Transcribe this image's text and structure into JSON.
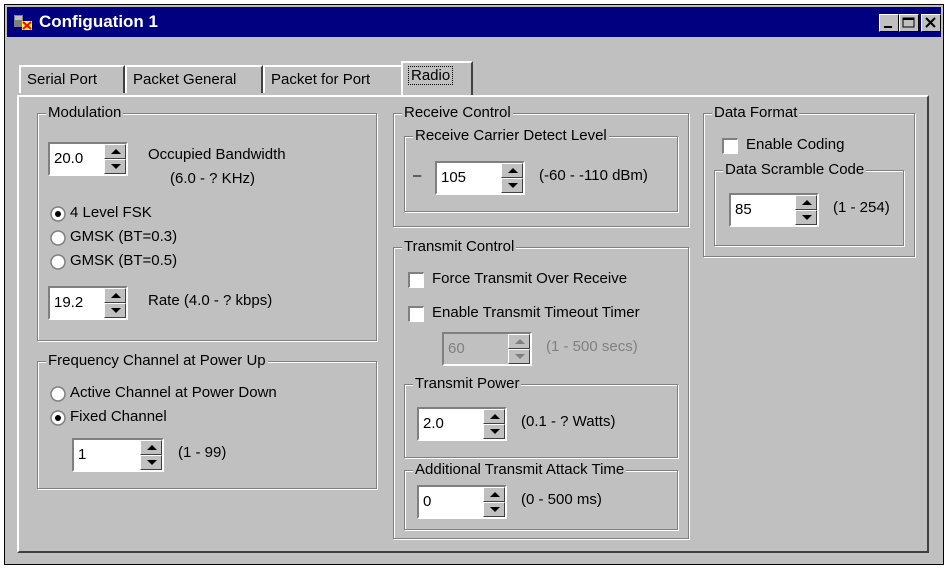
{
  "window": {
    "title": "Configuation 1"
  },
  "tabs": [
    {
      "label": "Serial Port"
    },
    {
      "label": "Packet General"
    },
    {
      "label": "Packet for Port"
    },
    {
      "label": "Radio",
      "active": true
    }
  ],
  "modulation": {
    "legend": "Modulation",
    "bandwidth_value": "20.0",
    "bandwidth_label": "Occupied Bandwidth",
    "bandwidth_range": "(6.0 - ? KHz)",
    "options": [
      {
        "label": "4 Level FSK",
        "selected": true
      },
      {
        "label": "GMSK (BT=0.3)",
        "selected": false
      },
      {
        "label": "GMSK (BT=0.5)",
        "selected": false
      }
    ],
    "rate_value": "19.2",
    "rate_label": "Rate (4.0 - ? kbps)"
  },
  "frequency": {
    "legend": "Frequency Channel at Power Up",
    "options": [
      {
        "label": "Active Channel at Power Down",
        "selected": false
      },
      {
        "label": "Fixed Channel",
        "selected": true
      }
    ],
    "channel_value": "1",
    "channel_range": "(1 - 99)"
  },
  "receive_control": {
    "legend": "Receive Control",
    "carrier_legend": "Receive Carrier Detect Level",
    "sign": "–",
    "level_value": "105",
    "level_range": "(-60 - -110 dBm)"
  },
  "transmit_control": {
    "legend": "Transmit Control",
    "force_label": "Force Transmit Over Receive",
    "force_checked": false,
    "timeout_label": "Enable Transmit Timeout Timer",
    "timeout_checked": false,
    "timeout_value": "60",
    "timeout_range": "(1 - 500 secs)",
    "power_legend": "Transmit Power",
    "power_value": "2.0",
    "power_range": "(0.1 - ? Watts)",
    "attack_legend": "Additional Transmit Attack Time",
    "attack_value": "0",
    "attack_range": "(0 - 500 ms)"
  },
  "data_format": {
    "legend": "Data Format",
    "coding_label": "Enable Coding",
    "coding_checked": false,
    "scramble_legend": "Data Scramble Code",
    "scramble_value": "85",
    "scramble_range": "(1 - 254)"
  }
}
